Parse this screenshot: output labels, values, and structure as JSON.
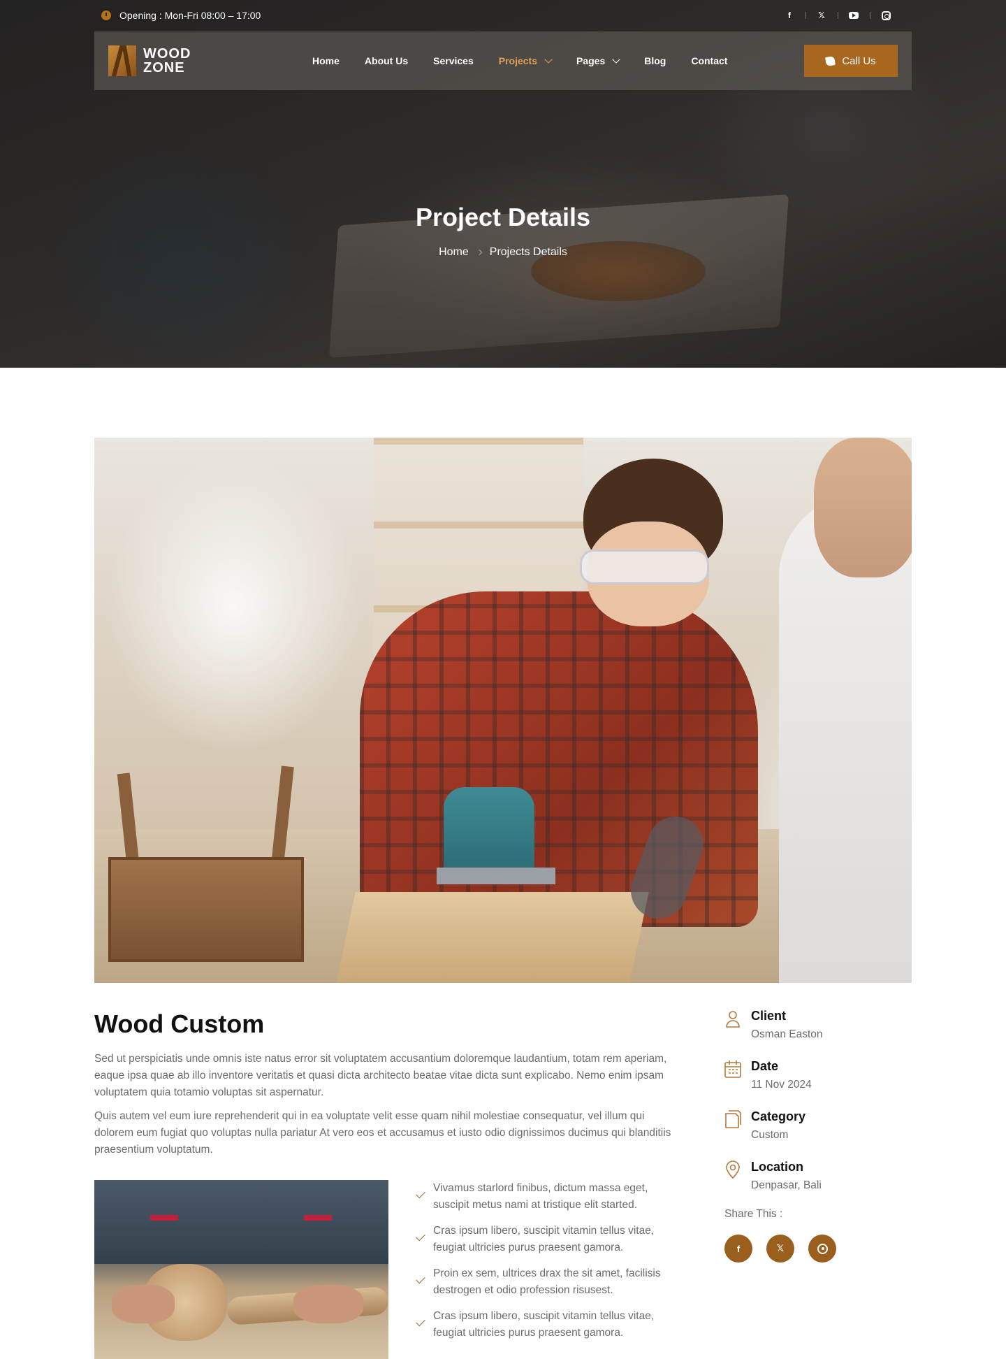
{
  "topbar": {
    "opening_text": "Opening : Mon-Fri 08:00 – 17:00",
    "socials": [
      {
        "icon": "facebook-icon",
        "glyph": "f"
      },
      {
        "icon": "x-icon",
        "glyph": "𝕏"
      },
      {
        "icon": "youtube-icon",
        "glyph": ""
      },
      {
        "icon": "instagram-icon",
        "glyph": ""
      }
    ]
  },
  "nav": {
    "logo_line1": "WOOD",
    "logo_line2": "ZONE",
    "items": [
      {
        "label": "Home"
      },
      {
        "label": "About Us"
      },
      {
        "label": "Services"
      },
      {
        "label": "Projects"
      },
      {
        "label": "Pages"
      },
      {
        "label": "Blog"
      },
      {
        "label": "Contact"
      }
    ],
    "call_button": "Call Us"
  },
  "hero": {
    "title": "Project Details",
    "breadcrumb": [
      "Home",
      "Projects Details"
    ]
  },
  "project": {
    "title": "Wood Custom",
    "paragraph1": "Sed ut perspiciatis unde omnis iste natus error sit voluptatem accusantium doloremque laudantium, totam rem aperiam, eaque ipsa quae ab illo inventore veritatis et quasi dicta architecto beatae vitae dicta sunt explicabo. Nemo enim ipsam voluptatem quia totamio voluptas sit aspernatur.",
    "paragraph2": "Quis autem vel eum iure reprehenderit qui in ea voluptate velit esse quam nihil molestiae consequatur, vel illum qui dolorem eum fugiat quo voluptas nulla pariatur At vero eos et accusamus et iusto odio dignissimos ducimus qui blanditiis praesentium voluptatum.",
    "checklist": [
      "Vivamus starlord finibus, dictum massa eget, suscipit metus nami at tristique elit started.",
      "Cras ipsum libero, suscipit vitamin tellus vitae, feugiat ultricies purus praesent gamora.",
      "Proin ex sem, ultrices drax the sit amet, facilisis destrogen et odio profession risusest.",
      "Cras ipsum libero, suscipit vitamin tellus vitae, feugiat ultricies purus praesent gamora."
    ]
  },
  "sidebar": {
    "info": [
      {
        "icon": "user-icon",
        "label": "Client",
        "value": "Osman Easton"
      },
      {
        "icon": "calendar-icon",
        "label": "Date",
        "value": "11 Nov 2024"
      },
      {
        "icon": "document-icon",
        "label": "Category",
        "value": "Custom"
      },
      {
        "icon": "location-pin-icon",
        "label": "Location",
        "value": "Denpasar, Bali"
      }
    ],
    "share_label": "Share This :",
    "share_buttons": [
      {
        "icon": "facebook-icon",
        "glyph": "f"
      },
      {
        "icon": "x-icon",
        "glyph": "𝕏"
      },
      {
        "icon": "whatsapp-icon",
        "glyph": ""
      }
    ]
  },
  "colors": {
    "accent": "#a8661f",
    "nav_active": "#e0a35a",
    "heading": "#111111",
    "body_text": "#6b6b6b"
  }
}
